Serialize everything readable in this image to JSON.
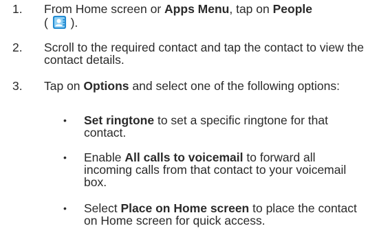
{
  "steps": [
    {
      "number": "1.",
      "line1_a": "From Home screen or ",
      "line1_b": "Apps Menu",
      "line1_c": ", tap on ",
      "line1_d": "People",
      "line2_a": "( ",
      "line2_b": " ).",
      "icon": "people-app-icon"
    },
    {
      "number": "2.",
      "text": "Scroll to the required contact and tap the contact to view the contact details."
    },
    {
      "number": "3.",
      "text_a": "Tap on ",
      "text_b": "Options",
      "text_c": " and select one of the following options:"
    }
  ],
  "options": [
    {
      "bold_prefix": "",
      "bold": "Set ringtone",
      "rest": " to set a specific ringtone for that contact."
    },
    {
      "bold_prefix": "Enable ",
      "bold": "All calls to voicemail",
      "rest": " to forward all incoming calls from that contact to your voicemail box."
    },
    {
      "bold_prefix": "Select ",
      "bold": "Place on Home screen",
      "rest": " to place the contact on Home screen for quick access."
    }
  ],
  "bullet_glyph": "•",
  "colors": {
    "text": "#2a2a2a",
    "icon_blue": "#1e88d0",
    "icon_light": "#8fd0f5"
  }
}
